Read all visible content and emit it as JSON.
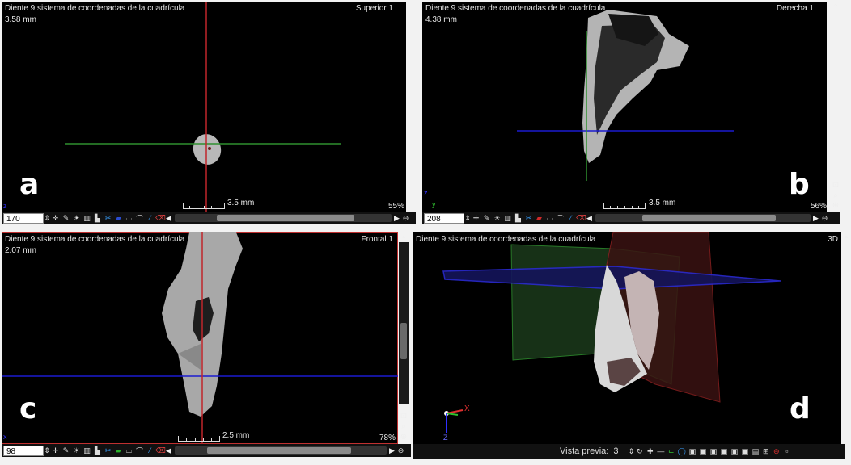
{
  "panels": {
    "a": {
      "title": "Diente 9 sistema de coordenadas de la cuadrícula",
      "view": "Superior 1",
      "depth": "3.58 mm",
      "letter": "a",
      "scale": "3.5 mm",
      "zoom": "55%",
      "slice": "170"
    },
    "b": {
      "title": "Diente 9 sistema de coordenadas de la cuadrícula",
      "view": "Derecha 1",
      "depth": "4.38 mm",
      "letter": "b",
      "scale": "3.5 mm",
      "zoom": "56%",
      "slice": "208"
    },
    "c": {
      "title": "Diente 9 sistema de coordenadas de la cuadrícula",
      "view": "Frontal 1",
      "depth": "2.07 mm",
      "letter": "c",
      "scale": "2.5 mm",
      "zoom": "78%",
      "slice": "98"
    },
    "d": {
      "title": "Diente 9 sistema de coordenadas de la cuadrícula",
      "view": "3D",
      "letter": "d",
      "preview_label": "Vista previa:",
      "preview_value": "3"
    }
  },
  "axes": {
    "x": "x",
    "y": "y",
    "z": "z",
    "X": "X",
    "Z": "Z"
  },
  "colors": {
    "crosshair_red": "#c0262b",
    "crosshair_green": "#2f8f2f",
    "crosshair_blue": "#1a1ad0",
    "active_border": "#c03030"
  }
}
